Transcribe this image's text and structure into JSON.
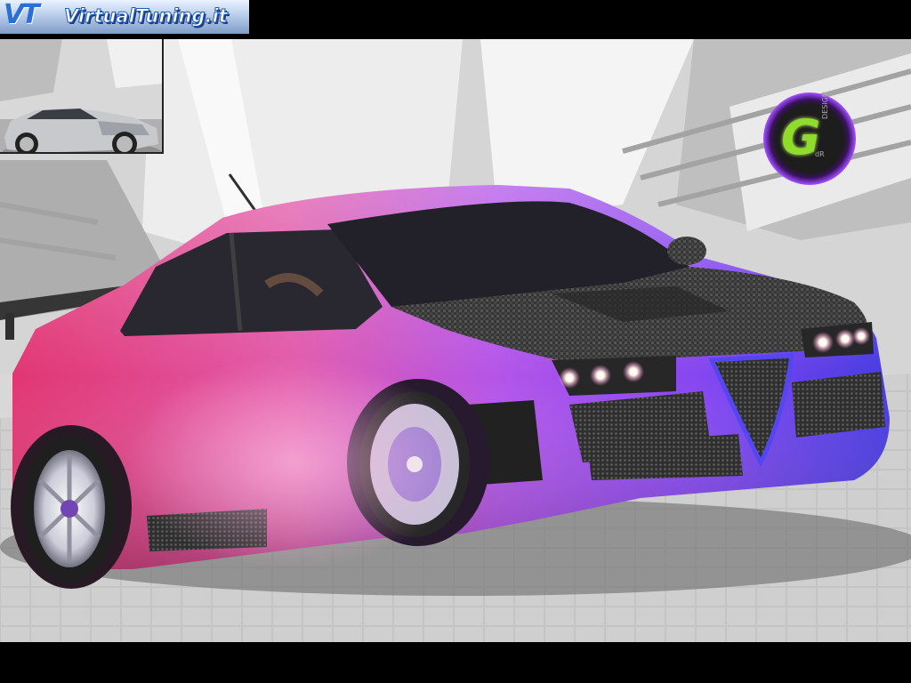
{
  "banner": {
    "logo_mark": "VT",
    "site_name": "VirtualTuning.it"
  },
  "designer_logo": {
    "letter": "G",
    "tag_design": "DESIGN",
    "tag_initials": "dR"
  },
  "colors": {
    "body_pink": "#e2418f",
    "body_purple": "#9a3ff0",
    "body_blue": "#3a2ee0",
    "carbon_hood": "#2b2b2b",
    "logo_glow": "#9f4cff",
    "logo_letter": "#8fdc2a",
    "banner_blue": "#2b6fd6"
  },
  "subjects": {
    "main": "tuned sedan with pink-to-blue paint and carbon hood",
    "inset": "stock silver sedan"
  }
}
